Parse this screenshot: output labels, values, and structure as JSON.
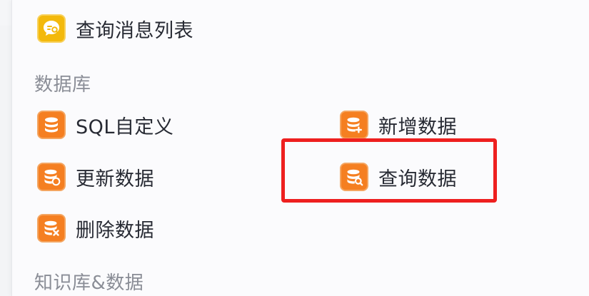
{
  "items": {
    "query_messages": {
      "label": "查询消息列表",
      "icon": "chat-search-icon"
    },
    "sql_custom": {
      "label": "SQL自定义",
      "icon": "database-icon"
    },
    "add_data": {
      "label": "新增数据",
      "icon": "database-add-icon"
    },
    "update_data": {
      "label": "更新数据",
      "icon": "database-refresh-icon"
    },
    "query_data": {
      "label": "查询数据",
      "icon": "database-search-icon"
    },
    "delete_data": {
      "label": "删除数据",
      "icon": "database-delete-icon"
    }
  },
  "sections": {
    "database": "数据库",
    "knowledge_and_data": "知识库&数据"
  },
  "colors": {
    "accent_orange": "#f57f21",
    "accent_yellow": "#f3b90c",
    "highlight": "#ee1f1f"
  }
}
